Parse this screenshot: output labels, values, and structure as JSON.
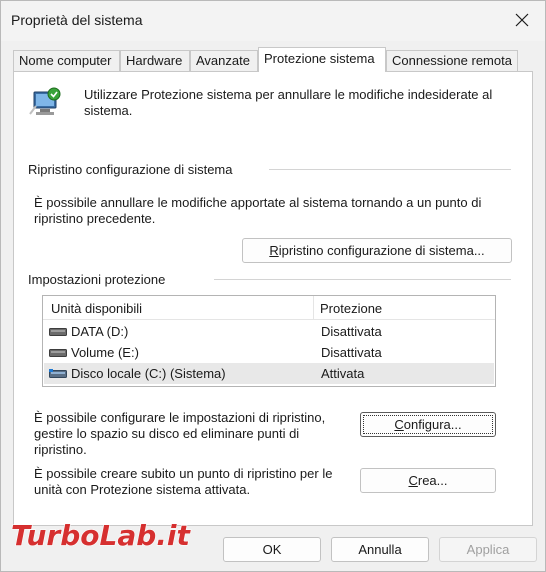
{
  "window": {
    "title": "Proprietà del sistema"
  },
  "tabs": [
    {
      "label": "Nome computer",
      "active": false
    },
    {
      "label": "Hardware",
      "active": false
    },
    {
      "label": "Avanzate",
      "active": false
    },
    {
      "label": "Protezione sistema",
      "active": true
    },
    {
      "label": "Connessione remota",
      "active": false
    }
  ],
  "intro": {
    "text": "Utilizzare Protezione sistema per annullare le modifiche indesiderate al sistema."
  },
  "restore": {
    "group_label": "Ripristino configurazione di sistema",
    "description": "È possibile annullare le modifiche apportate al sistema tornando a un punto di ripristino precedente.",
    "button_label_first": "R",
    "button_label_rest": "ipristino configurazione di sistema..."
  },
  "protection": {
    "group_label": "Impostazioni protezione",
    "columns": {
      "drive": "Unità disponibili",
      "protection": "Protezione"
    },
    "rows": [
      {
        "name": "DATA (D:)",
        "protection": "Disattivata",
        "icon": "drive-icon",
        "selected": false
      },
      {
        "name": "Volume (E:)",
        "protection": "Disattivata",
        "icon": "drive-icon",
        "selected": false
      },
      {
        "name": "Disco locale (C:) (Sistema)",
        "protection": "Attivata",
        "icon": "system-drive-icon",
        "selected": true
      }
    ],
    "configure_text": "È possibile configurare le impostazioni di ripristino, gestire lo spazio su disco ed eliminare punti di ripristino.",
    "configure_btn_first": "C",
    "configure_btn_rest": "onfigura...",
    "create_text": "È possibile creare subito un punto di ripristino per le unità con Protezione sistema attivata.",
    "create_btn_first": "C",
    "create_btn_rest": "rea..."
  },
  "footer": {
    "ok": "OK",
    "cancel": "Annulla",
    "apply": "Applica"
  },
  "watermark": {
    "text": "TurboLab.it"
  },
  "colors": {
    "panel_bg": "#ffffff",
    "window_bg": "#f0f0f0",
    "watermark_red": "#d42020"
  }
}
